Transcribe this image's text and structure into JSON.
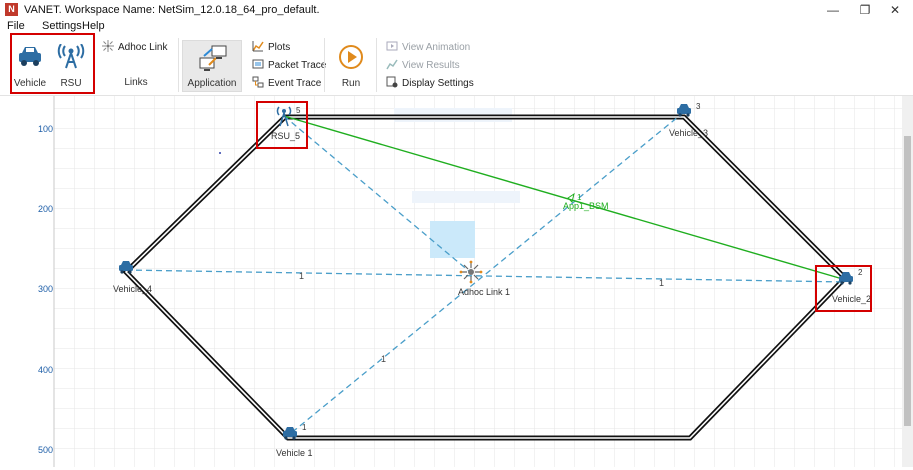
{
  "window": {
    "title": "VANET. Workspace Name: NetSim_12.0.18_64_pro_default.",
    "app_icon_letter": "N",
    "minimize": "—",
    "restore": "❐",
    "close": "✕"
  },
  "menu": [
    "File",
    "Settings",
    "Help"
  ],
  "ribbon": {
    "vehicle_label": "Vehicle",
    "rsu_label": "RSU",
    "adhoc_link_label": "Adhoc Link",
    "links_group_label": "Links",
    "application_label": "Application",
    "plots_label": "Plots",
    "packet_trace_label": "Packet Trace",
    "event_trace_label": "Event Trace",
    "run_label": "Run",
    "view_animation_label": "View Animation",
    "view_results_label": "View Results",
    "display_settings_label": "Display Settings"
  },
  "canvas": {
    "y_ticks": [
      "100",
      "200",
      "300",
      "400",
      "500"
    ],
    "nodes": {
      "rsu5": {
        "label": "RSU_5",
        "id": "5"
      },
      "vehicle3": {
        "label": "Vehicle_3",
        "id": "3"
      },
      "vehicle4": {
        "label": "Vehicle_4"
      },
      "vehicle2": {
        "label": "Vehicle_2",
        "id": "2"
      },
      "vehicle1": {
        "label": "Vehicle 1",
        "id": "1"
      },
      "adhoc": {
        "label": "Adhoc Link 1"
      }
    },
    "app_label": "App1_BSM",
    "app_link_id": "1",
    "link_labels": [
      "1",
      "1",
      "1"
    ]
  },
  "colors": {
    "road": "#111111",
    "wireless_link": "#4a9ec9",
    "app_flow": "#1fae1f",
    "highlight_box": "#d40000",
    "grid": "#e6e6e6",
    "axis_text": "#1f5fa8"
  }
}
